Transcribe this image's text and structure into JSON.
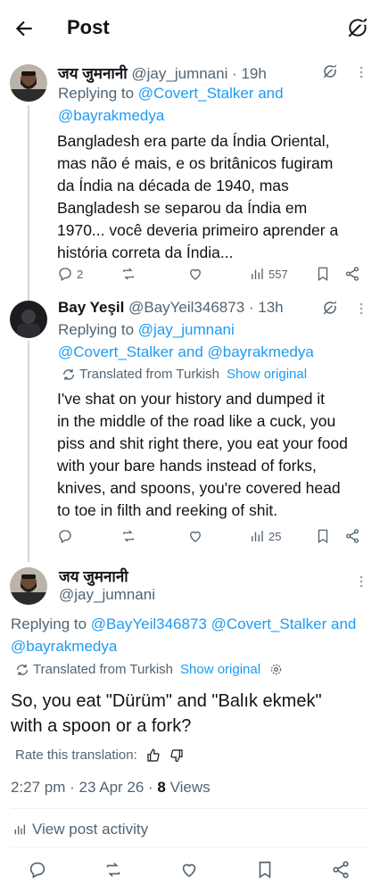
{
  "header": {
    "title": "Post"
  },
  "post1": {
    "name": "जय जुमनानी",
    "handle": "@jay_jumnani · 19h",
    "replying_label": "Replying to",
    "replying_1": "@Covert_Stalker and",
    "replying_2": "@bayrakmedya",
    "lines": [
      "Bangladesh era parte da Índia Oriental,",
      "mas não é mais, e os britânicos fugiram",
      "da Índia na década de 1940, mas",
      "Bangladesh se separou da Índia em",
      "1970... você deveria primeiro aprender a",
      "história correta da Índia..."
    ],
    "replies": "2",
    "views": "557"
  },
  "post2": {
    "name": "Bay Yeşil",
    "handle": "@BayYeil346873 · 13h",
    "replying_label": "Replying to",
    "replying_1": "@jay_jumnani",
    "replying_2": "@Covert_Stalker and @bayrakmedya",
    "translated": "Translated from Turkish",
    "show_original": "Show original",
    "lines": [
      "I've shat on your history and dumped it",
      "in the middle of the road like a cuck, you",
      "piss and shit right there, you eat your food",
      "with your bare hands instead of forks,",
      "knives, and spoons, you're covered head",
      "to toe in filth and reeking of shit."
    ],
    "views": "25"
  },
  "main": {
    "name": "जय जुमनानी",
    "handle": "@jay_jumnani",
    "replying_label": "Replying to",
    "replying_1": "@BayYeil346873 @Covert_Stalker and",
    "replying_2": "@bayrakmedya",
    "translated": "Translated from Turkish",
    "show_original": "Show original",
    "line1": "So, you eat \"Dürüm\" and \"Balık ekmek\"",
    "line2": "with a spoon or a fork?",
    "rate_label": "Rate this translation:",
    "time": "2:27 pm · 23 Apr 26 · ",
    "views_count": "8",
    "views_label": " Views",
    "activity": "View post activity"
  },
  "colors": {
    "accent": "#1d9bf0",
    "muted": "#536471",
    "text": "#0f1419",
    "line": "#cfd9de"
  },
  "icons": [
    "back-arrow-icon",
    "grok-icon",
    "more-icon",
    "reply-icon",
    "repost-icon",
    "like-icon",
    "views-icon",
    "bookmark-icon",
    "share-icon",
    "translate-icon",
    "gear-icon",
    "thumbs-up-icon",
    "thumbs-down-icon"
  ]
}
